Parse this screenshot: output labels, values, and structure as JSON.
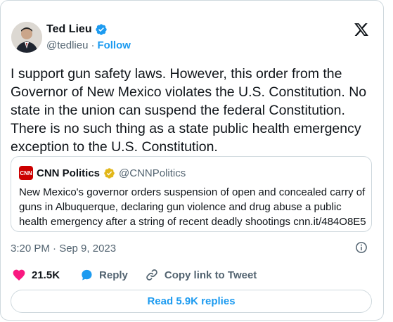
{
  "author": {
    "name": "Ted Lieu",
    "handle": "@tedlieu",
    "follow_label": "Follow"
  },
  "tweet": {
    "text": "I support gun safety laws. However, this order from the Governor of New Mexico violates the U.S. Constitution. No state in the union can suspend the federal Constitution. There is no such thing as a state public health emergency exception to the U.S. Constitution.",
    "timestamp": "3:20 PM · Sep 9, 2023"
  },
  "quoted": {
    "logo_text": "CNN",
    "name": "CNN Politics",
    "handle": "@CNNPolitics",
    "text": "New Mexico's governor orders suspension of open and concealed carry of guns in Albuquerque, declaring gun violence and drug abuse a public health emergency after a string of recent deadly shootings cnn.it/484O8E5"
  },
  "actions": {
    "likes": "21.5K",
    "reply_label": "Reply",
    "copy_label": "Copy link to Tweet"
  },
  "read_replies_label": "Read 5.9K replies",
  "colors": {
    "accent": "#1d9bf0",
    "like": "#f91880",
    "verified_gold": "#e2b719",
    "muted": "#536471",
    "border": "#cfd9de"
  }
}
